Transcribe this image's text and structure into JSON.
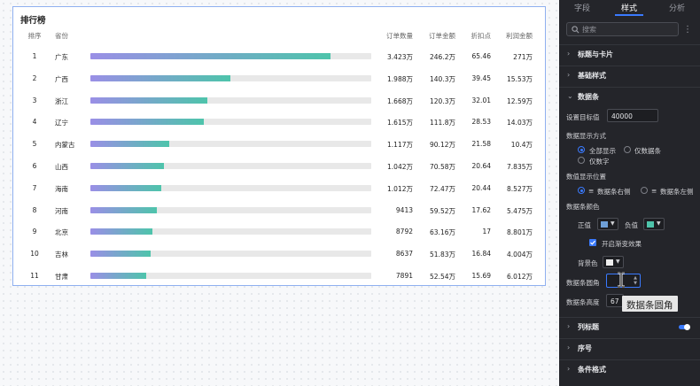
{
  "card": {
    "title": "排行榜",
    "columns": {
      "rank": "排序",
      "province": "省份",
      "orders": "订单数量",
      "amount": "订单金额",
      "discount": "折扣点",
      "profit": "利润金额"
    },
    "rows": [
      {
        "rank": "1",
        "province": "广东",
        "fill": 0.8558,
        "orders": "3.423万",
        "amount": "246.2万",
        "discount": "65.46",
        "profit": "271万"
      },
      {
        "rank": "2",
        "province": "广西",
        "fill": 0.497,
        "orders": "1.988万",
        "amount": "140.3万",
        "discount": "39.45",
        "profit": "15.53万"
      },
      {
        "rank": "3",
        "province": "浙江",
        "fill": 0.417,
        "orders": "1.668万",
        "amount": "120.3万",
        "discount": "32.01",
        "profit": "12.59万"
      },
      {
        "rank": "4",
        "province": "辽宁",
        "fill": 0.4038,
        "orders": "1.615万",
        "amount": "111.8万",
        "discount": "28.53",
        "profit": "14.03万"
      },
      {
        "rank": "5",
        "province": "内蒙古",
        "fill": 0.2793,
        "orders": "1.117万",
        "amount": "90.12万",
        "discount": "21.58",
        "profit": "10.4万"
      },
      {
        "rank": "6",
        "province": "山西",
        "fill": 0.2605,
        "orders": "1.042万",
        "amount": "70.58万",
        "discount": "20.64",
        "profit": "7.835万"
      },
      {
        "rank": "7",
        "province": "海南",
        "fill": 0.253,
        "orders": "1.012万",
        "amount": "72.47万",
        "discount": "20.44",
        "profit": "8.527万"
      },
      {
        "rank": "8",
        "province": "河南",
        "fill": 0.2353,
        "orders": "9413",
        "amount": "59.52万",
        "discount": "17.62",
        "profit": "5.475万"
      },
      {
        "rank": "9",
        "province": "北京",
        "fill": 0.2198,
        "orders": "8792",
        "amount": "63.16万",
        "discount": "17",
        "profit": "8.801万"
      },
      {
        "rank": "10",
        "province": "吉林",
        "fill": 0.2159,
        "orders": "8637",
        "amount": "51.83万",
        "discount": "16.84",
        "profit": "4.004万"
      },
      {
        "rank": "11",
        "province": "甘肃",
        "fill": 0.1973,
        "orders": "7891",
        "amount": "52.54万",
        "discount": "15.69",
        "profit": "6.012万"
      }
    ],
    "colors": {
      "bar_start": "#9a8fe6",
      "bar_end": "#4ec4ab",
      "track": "#e8e8e8",
      "border": "#8fb0f0"
    }
  },
  "panel": {
    "tabs": [
      "字段",
      "样式",
      "分析"
    ],
    "active_tab": "样式",
    "search_placeholder": "搜索",
    "more_icon": "more-vertical-icon",
    "sections": {
      "title_card": "标题与卡片",
      "basic_style": "基础样式",
      "data_bar": "数据条",
      "column_title": "列标题",
      "serial": "序号",
      "conditional_format": "条件格式"
    },
    "target_label": "设置目标值",
    "target_value": "40000",
    "display_mode_label": "数据显示方式",
    "display_modes": [
      "全部显示",
      "仅数据条",
      "仅数字"
    ],
    "display_mode_selected": "全部显示",
    "position_label": "数值显示位置",
    "positions": [
      "数据条右侧",
      "数据条左侧"
    ],
    "position_selected": "数据条右侧",
    "bar_color_label": "数据条颜色",
    "positive_label": "正值",
    "negative_label": "负值",
    "positive_color": "#6fa0d8",
    "negative_color": "#4ec4ab",
    "gradient_label": "开启渐变效果",
    "gradient_checked": true,
    "bg_color_label": "背景色",
    "bg_color": "#eeeeee",
    "radius_label": "数据条圆角",
    "height_label": "数据条高度",
    "height_value": "67",
    "column_title_toggle": true,
    "tooltip": "数据条圆角",
    "accent": "#3a7afe"
  }
}
